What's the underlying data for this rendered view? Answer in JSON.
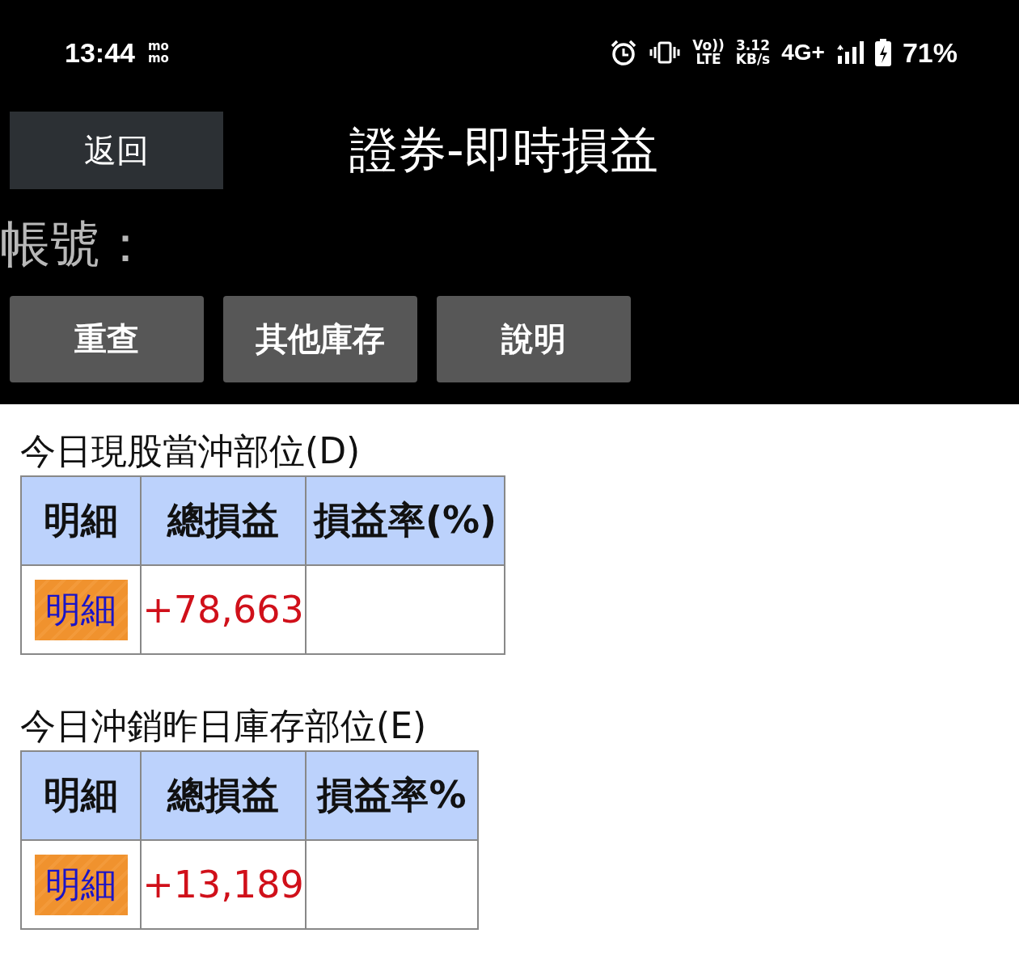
{
  "status_bar": {
    "time": "13:44",
    "notification_text": [
      "mo",
      "mo"
    ],
    "volte": [
      "Vo))",
      "LTE"
    ],
    "speed": [
      "3.12",
      "KB/s"
    ],
    "network": "4G+",
    "battery": "71%"
  },
  "header": {
    "back_button": "返回",
    "title": "證券-即時損益"
  },
  "account": {
    "label": "帳號："
  },
  "buttons": [
    "重查",
    "其他庫存",
    "說明"
  ],
  "sections": [
    {
      "title": "今日現股當沖部位(D)",
      "columns": [
        "明細",
        "總損益",
        "損益率(%)"
      ],
      "rows": [
        {
          "detail_button": "明細",
          "total": "+78,663"
        }
      ]
    },
    {
      "title": "今日沖銷昨日庫存部位(E)",
      "columns": [
        "明細",
        "總損益",
        "損益率%"
      ],
      "rows": [
        {
          "detail_button": "明細",
          "total": "+13,189"
        }
      ]
    }
  ]
}
